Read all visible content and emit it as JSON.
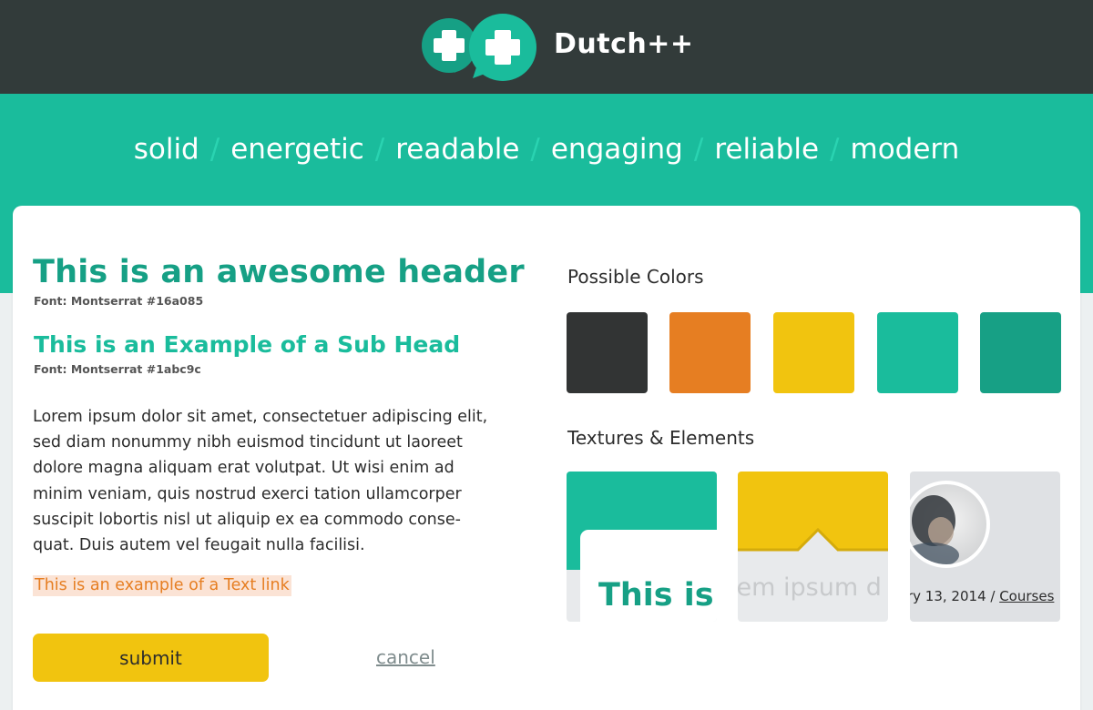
{
  "brand": {
    "name": "Dutch++",
    "icon": "double-plus-chat-icon"
  },
  "tagline": [
    "solid",
    "energetic",
    "readable",
    "engaging",
    "reliable",
    "modern"
  ],
  "tagline_separator": "/",
  "typography": {
    "header": "This is an awesome header",
    "header_note": "Font: Montserrat #16a085",
    "subhead": "This is an Example of a Sub Head",
    "subhead_note": "Font: Montserrat #1abc9c",
    "body_lines": [
      "Lorem ipsum dolor sit amet, consectetuer adipiscing elit,",
      "sed diam nonummy nibh euismod tincidunt ut laoreet",
      "dolore magna aliquam erat volutpat. Ut wisi enim ad",
      "minim veniam, quis nostrud exerci tation ullamcorper",
      "suscipit lobortis nisl ut aliquip ex ea commodo conse-",
      "quat. Duis autem vel feugait nulla facilisi."
    ],
    "text_link": "This is an example of a Text link"
  },
  "buttons": {
    "submit": "submit",
    "cancel": "cancel"
  },
  "colors": {
    "title": "Possible Colors",
    "swatches": [
      "#323434",
      "#e67e22",
      "#f1c40f",
      "#1abc9c",
      "#17a085"
    ]
  },
  "textures": {
    "title": "Textures & Elements",
    "tile1_text": "This is a",
    "tile2_text": "rem ipsum d",
    "tile3_date": "ry 13, 2014 / ",
    "tile3_link": "Courses"
  },
  "theme": {
    "dark": "#323b3a",
    "teal": "#1abc9c",
    "teal_dark": "#16a085",
    "yellow": "#f1c40f",
    "orange": "#e67e22"
  }
}
